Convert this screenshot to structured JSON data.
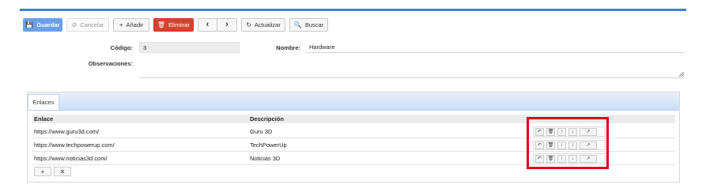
{
  "toolbar": {
    "save": "Guardar",
    "cancel": "Cancelar",
    "add": "Añadir",
    "delete": "Eliminar",
    "prev": "‹",
    "next": "›",
    "refresh": "Actualizar",
    "search": "Buscar"
  },
  "form": {
    "codigo_label": "Código:",
    "codigo_value": "3",
    "nombre_label": "Nombre:",
    "nombre_value": "Hardware",
    "obs_label": "Observaciones:"
  },
  "tabs": [
    {
      "label": "Enlaces"
    }
  ],
  "grid": {
    "headers": [
      "Enlace",
      "Descripción"
    ],
    "rows": [
      {
        "enlace": "https://www.guru3d.com/",
        "descripcion": "Guru 3D"
      },
      {
        "enlace": "https://www.techpowerup.com/",
        "descripcion": "TechPowerUp"
      },
      {
        "enlace": "https://www.noticias3d.com/",
        "descripcion": "Noticias 3D"
      }
    ]
  },
  "colors": {
    "accent": "#3f7fd9",
    "danger": "#d9412f",
    "highlight": "#e0001b"
  }
}
